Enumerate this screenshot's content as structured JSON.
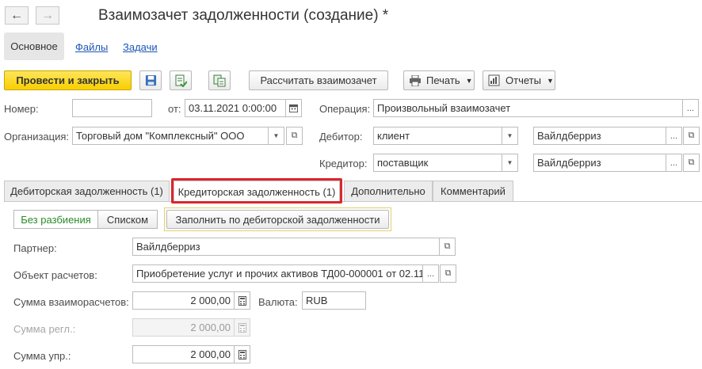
{
  "window": {
    "title": "Взаимозачет задолженности (создание) *"
  },
  "sections": {
    "main": "Основное",
    "files": "Файлы",
    "tasks": "Задачи"
  },
  "toolbar": {
    "post_close": "Провести и закрыть",
    "calc": "Рассчитать взаимозачет",
    "print": "Печать",
    "reports": "Отчеты"
  },
  "form": {
    "number_label": "Номер:",
    "number_value": "",
    "date_label": "от:",
    "date_value": "03.11.2021  0:00:00",
    "operation_label": "Операция:",
    "operation_value": "Произвольный взаимозачет",
    "org_label": "Организация:",
    "org_value": "Торговый дом \"Комплексный\" ООО",
    "debtor_label": "Дебитор:",
    "debtor_type": "клиент",
    "debtor_value": "Вайлдберриз",
    "creditor_label": "Кредитор:",
    "creditor_type": "поставщик",
    "creditor_value": "Вайлдберриз"
  },
  "tabs": [
    {
      "label": "Дебиторская задолженность (1)"
    },
    {
      "label": "Кредиторская задолженность (1)"
    },
    {
      "label": "Дополнительно"
    },
    {
      "label": "Комментарий"
    }
  ],
  "tab_content": {
    "mode_no_split": "Без разбиения",
    "mode_list": "Списком",
    "fill_button": "Заполнить по дебиторской задолженности",
    "partner_label": "Партнер:",
    "partner_value": "Вайлдберриз",
    "object_label": "Объект расчетов:",
    "object_value": "Приобретение услуг и прочих активов ТД00-000001 от 02.11.",
    "sum_label": "Сумма взаиморасчетов:",
    "sum_value": "2 000,00",
    "currency_label": "Валюта:",
    "currency_value": "RUB",
    "sum_reg_label": "Сумма регл.:",
    "sum_reg_value": "2 000,00",
    "sum_mgmt_label": "Сумма упр.:",
    "sum_mgmt_value": "2 000,00"
  },
  "colors": {
    "primary": "#f7cf00",
    "highlight": "#d9262c",
    "link": "#1c56b4"
  }
}
